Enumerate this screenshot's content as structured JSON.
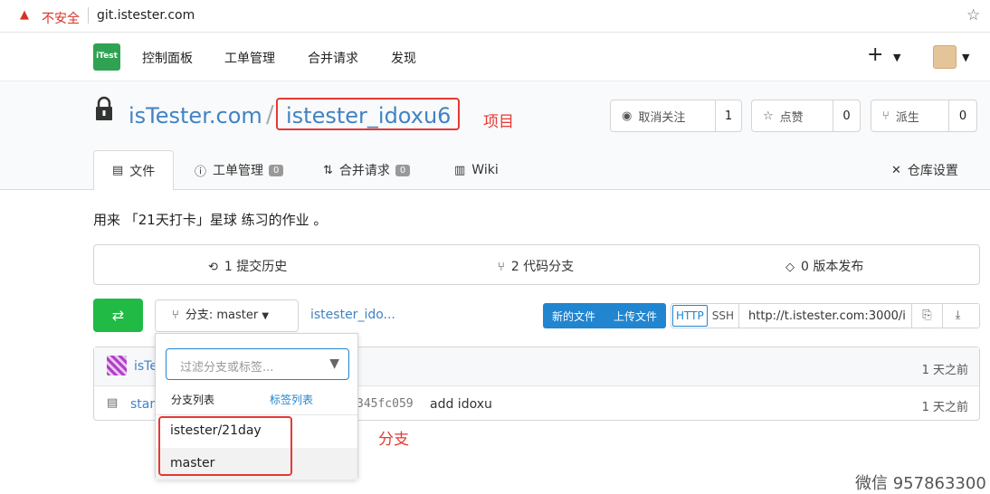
{
  "browser": {
    "security_label": "不安全",
    "url": "git.istester.com"
  },
  "nav": {
    "logo_text": "iTest",
    "items": [
      "控制面板",
      "工单管理",
      "合并请求",
      "发现"
    ],
    "plus": "+"
  },
  "repo": {
    "owner": "isTester.com",
    "name": "istester_idoxu6",
    "annotation": "项目"
  },
  "actions": {
    "watch_label": "取消关注",
    "watch_count": "1",
    "star_label": "点赞",
    "star_count": "0",
    "fork_label": "派生",
    "fork_count": "0"
  },
  "tabs": {
    "files": "文件",
    "issues": "工单管理",
    "issues_count": "0",
    "pulls": "合并请求",
    "pulls_count": "0",
    "wiki": "Wiki",
    "settings": "仓库设置"
  },
  "description": "用来 「21天打卡」星球 练习的作业 。",
  "stats": {
    "commits": "1 提交历史",
    "branches": "2 代码分支",
    "releases": "0 版本发布"
  },
  "toolbar": {
    "branch_label": "分支: master",
    "path": "istester_ido...",
    "new_file": "新的文件",
    "upload": "上传文件",
    "http": "HTTP",
    "ssh": "SSH",
    "clone_url": "http://t.istester.com:3000/i"
  },
  "files": {
    "latest_user": "isTe",
    "latest_time": "1 天之前",
    "file_name": "start",
    "sha": "345fc059",
    "message": "add idoxu",
    "file_time": "1 天之前"
  },
  "dropdown": {
    "filter_placeholder": "过滤分支或标签...",
    "tab_branches": "分支列表",
    "tab_tags": "标签列表",
    "branches": [
      "istester/21day",
      "master"
    ],
    "annotation": "分支"
  },
  "colors": {
    "primary": "#2185d0",
    "green": "#21ba45",
    "annotation_red": "#e53935",
    "link": "#4183c4"
  },
  "watermark": "微信 957863300"
}
